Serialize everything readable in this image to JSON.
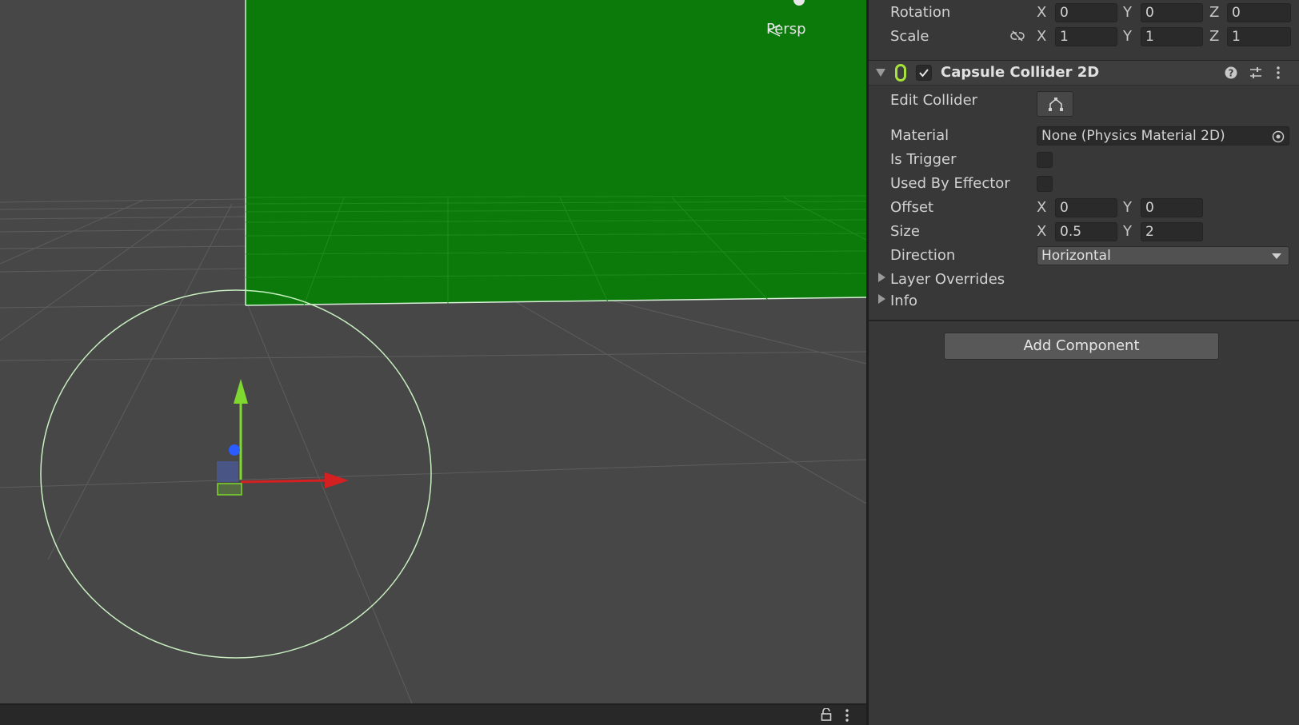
{
  "scene_view": {
    "persp_label": "Persp",
    "background_color": "#474747",
    "plane_color": "#0c7a0c",
    "icons": [
      "persp-arrow-icon",
      "lock-icon",
      "kebab-menu-icon"
    ]
  },
  "inspector": {
    "transform": {
      "rotation": {
        "label": "Rotation",
        "x_axis": "X",
        "y_axis": "Y",
        "z_axis": "Z",
        "x": "0",
        "y": "0",
        "z": "0"
      },
      "scale": {
        "label": "Scale",
        "x_axis": "X",
        "y_axis": "Y",
        "z_axis": "Z",
        "x": "1",
        "y": "1",
        "z": "1",
        "link_icon": "unlinked-chain-icon"
      }
    },
    "capsule_collider": {
      "title": "Capsule Collider 2D",
      "enabled": true,
      "edit_collider_label": "Edit Collider",
      "material_label": "Material",
      "material_value": "None (Physics Material 2D)",
      "is_trigger_label": "Is Trigger",
      "is_trigger": false,
      "used_by_effector_label": "Used By Effector",
      "used_by_effector": false,
      "offset": {
        "label": "Offset",
        "x_axis": "X",
        "y_axis": "Y",
        "x": "0",
        "y": "0"
      },
      "size": {
        "label": "Size",
        "x_axis": "X",
        "y_axis": "Y",
        "x": "0.5",
        "y": "2"
      },
      "direction_label": "Direction",
      "direction_value": "Horizontal",
      "layer_overrides_label": "Layer Overrides",
      "info_label": "Info"
    },
    "add_component_label": "Add Component"
  }
}
